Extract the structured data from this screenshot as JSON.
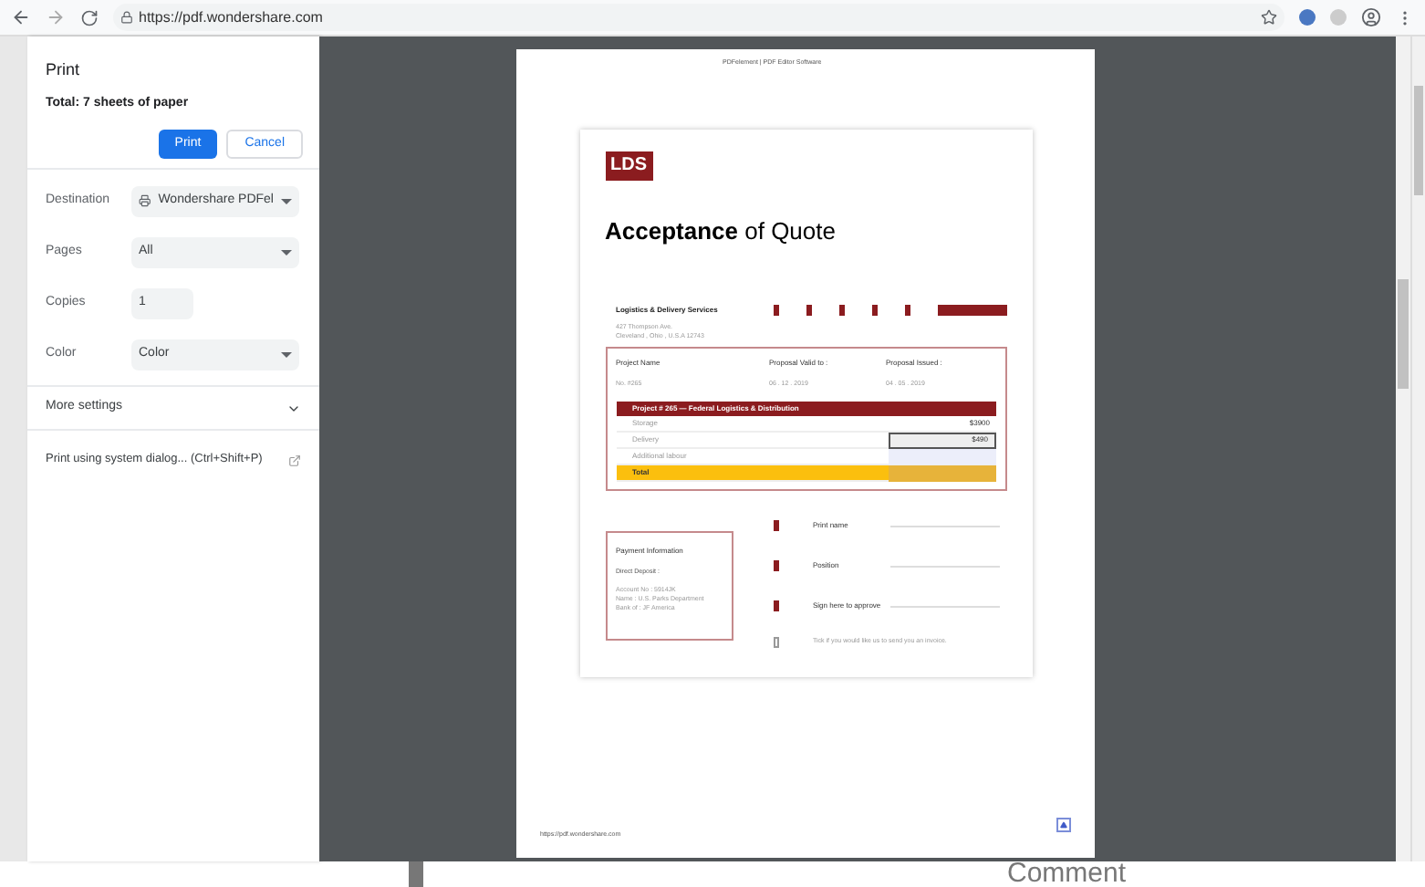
{
  "browser": {
    "url": "https://pdf.wondershare.com"
  },
  "print_panel": {
    "title": "Print",
    "total": "Total: 7 sheets of paper",
    "buttons": [
      {
        "label": "Print",
        "kind": "primary"
      },
      {
        "label": "Cancel",
        "kind": "secondary"
      }
    ],
    "settings": [
      {
        "label": "Destination",
        "value": "Wondershare PDFel",
        "kind": "select",
        "printer": true
      },
      {
        "label": "Pages",
        "value": "All",
        "kind": "select",
        "printer": false
      },
      {
        "label": "Copies",
        "value": "1",
        "kind": "input",
        "printer": false
      },
      {
        "label": "Color",
        "value": "Color",
        "kind": "select",
        "printer": false
      }
    ],
    "more_settings": {
      "label": "More settings",
      "expanded": false
    },
    "system_dialog": "Print using system dialog... (Ctrl+Shift+P)"
  },
  "preview": {
    "header_title": "PDFelement | PDF Editor Software",
    "footer_url": "https://pdf.wondershare.com",
    "document": {
      "logo": "LDS",
      "heading_bold": "Acceptance",
      "heading_rest": "of Quote",
      "company": "Logistics & Delivery Services",
      "address": [
        "427 Thompson Ave.",
        "Cleveland , Ohio , U.S.A 12743"
      ],
      "fields": [
        {
          "label": "Project Name",
          "value": "No. #265"
        },
        {
          "label": "Proposal Valid to :",
          "value": "06 . 12 . 2019"
        },
        {
          "label": "Proposal Issued :",
          "value": "04 . 05 . 2019"
        }
      ],
      "table_title": "Project # 265 — Federal Logistics & Distribution",
      "rows": [
        {
          "item": "Storage",
          "amount": "$3900",
          "kind": "plain"
        },
        {
          "item": "Delivery",
          "amount": "$490",
          "kind": "boxed"
        },
        {
          "item": "Additional labour",
          "amount": "",
          "kind": "shaded"
        },
        {
          "item": "Total",
          "amount": "",
          "kind": "total"
        }
      ],
      "payment": {
        "title": "Payment Information",
        "subtitle": "Direct Deposit :",
        "lines": [
          "Account No : 5914JK",
          "Name : U.S. Parks Department",
          "Bank of : JF America"
        ]
      },
      "signatures": [
        "Print name",
        "Position",
        "Sign here to approve"
      ],
      "invoice_note": "Tick if you would like us to send you an invoice.",
      "invoice_checked": false
    }
  },
  "background": {
    "comment": "Comment"
  }
}
